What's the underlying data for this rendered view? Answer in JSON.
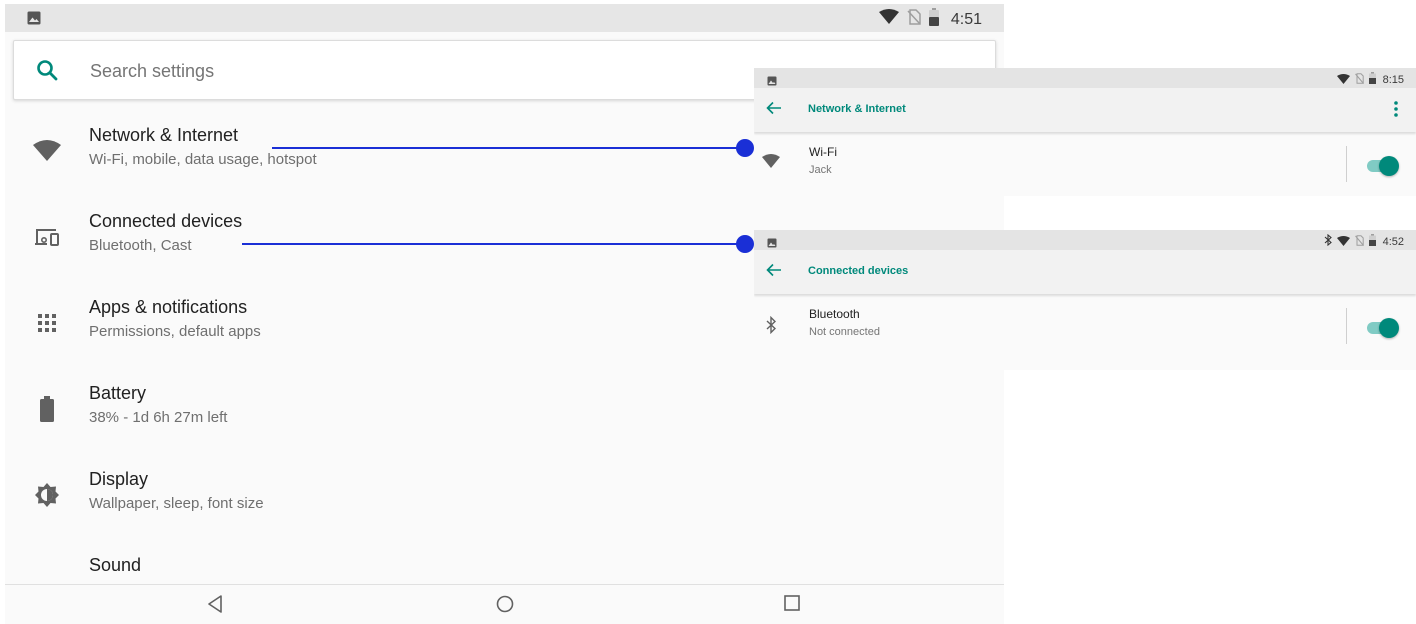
{
  "status_bar": {
    "time": "4:51"
  },
  "search": {
    "placeholder": "Search settings"
  },
  "settings_items": [
    {
      "title": "Network & Internet",
      "subtitle": "Wi-Fi, mobile, data usage, hotspot",
      "icon": "wifi-icon"
    },
    {
      "title": "Connected devices",
      "subtitle": "Bluetooth, Cast",
      "icon": "devices-icon"
    },
    {
      "title": "Apps & notifications",
      "subtitle": "Permissions, default apps",
      "icon": "apps-grid-icon"
    },
    {
      "title": "Battery",
      "subtitle": "38% - 1d 6h 27m left",
      "icon": "battery-icon"
    },
    {
      "title": "Display",
      "subtitle": "Wallpaper, sleep, font size",
      "icon": "brightness-icon"
    },
    {
      "title": "Sound",
      "subtitle": "",
      "icon": "volume-icon"
    }
  ],
  "nav_bar": {
    "buttons": [
      "back-icon",
      "home-icon",
      "recents-icon"
    ]
  },
  "network_inset": {
    "time": "8:15",
    "title": "Network & Internet",
    "row": {
      "title": "Wi-Fi",
      "subtitle": "Jack",
      "toggle_on": true
    }
  },
  "devices_inset": {
    "time": "4:52",
    "title": "Connected devices",
    "row": {
      "title": "Bluetooth",
      "subtitle": "Not connected",
      "toggle_on": true
    }
  },
  "colors": {
    "accent": "#00897b",
    "callout": "#1a2fd6",
    "toggle_track": "#80cbc4"
  }
}
